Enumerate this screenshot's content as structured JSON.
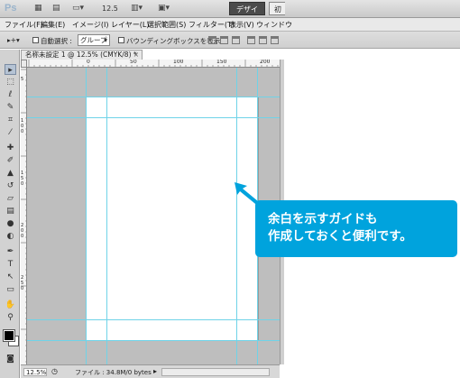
{
  "app": {
    "logo": "Ps",
    "zoom_popup": "12.5",
    "workspace_active": "デザイン",
    "workspace_other": "初期"
  },
  "menu": [
    "ファイル(F)",
    "編集(E)",
    "イメージ(I)",
    "レイヤー(L)",
    "選択範囲(S)",
    "フィルター(T)",
    "表示(V)",
    "ウィンドウ"
  ],
  "options": {
    "auto_select_label": "自動選択 :",
    "auto_select_value": "グループ",
    "bounding_box_label": "バウンディングボックスを表示"
  },
  "document": {
    "tab_title": "名称未設定 1 @ 12.5% (CMYK/8) *",
    "close_glyph": "×"
  },
  "ruler": {
    "h_labels": [
      "0",
      "50",
      "100",
      "150",
      "200"
    ],
    "v_labels": [
      "5",
      "1",
      "0",
      "0",
      "1",
      "5",
      "0",
      "2",
      "0",
      "0",
      "2",
      "5",
      "0"
    ]
  },
  "status": {
    "zoom": "12.5%",
    "file_info": "ファイル : 34.8M/0 bytes"
  },
  "callout": {
    "line1": "余白を示すガイドも",
    "line2": "作成しておくと便利です。",
    "color": "#00a3dd"
  },
  "colors": {
    "guide": "#6fd3e8",
    "pasteboard": "#bebebe",
    "foreground": "#000000",
    "background": "#ffffff"
  },
  "tools": [
    "move-icon",
    "marquee-icon",
    "lasso-icon",
    "quick-select-icon",
    "crop-icon",
    "eyedropper-icon",
    "healing-icon",
    "brush-icon",
    "stamp-icon",
    "history-brush-icon",
    "eraser-icon",
    "gradient-icon",
    "blur-icon",
    "dodge-icon",
    "pen-icon",
    "type-icon",
    "path-select-icon",
    "shape-icon",
    "hand-icon",
    "zoom-icon"
  ]
}
